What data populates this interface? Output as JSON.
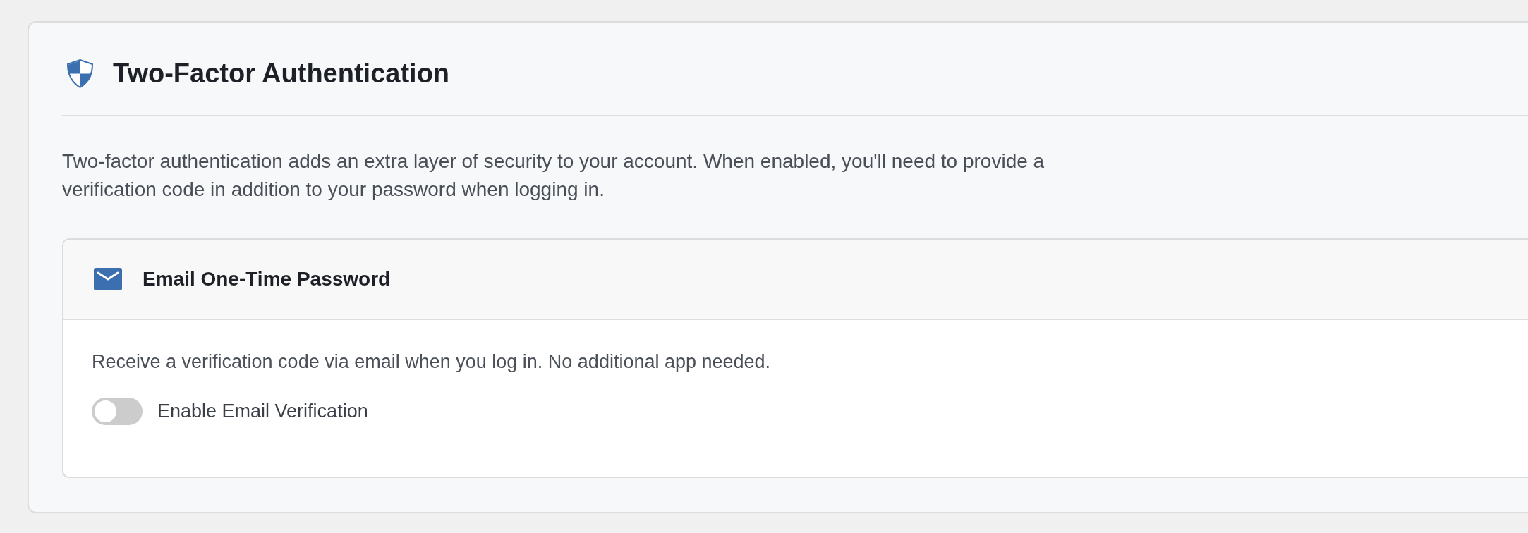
{
  "panel": {
    "title": "Two-Factor Authentication",
    "description": "Two-factor authentication adds an extra layer of security to your account. When enabled, you'll need to provide a verification code in addition to your password when logging in."
  },
  "methods": [
    {
      "title": "Email One-Time Password",
      "description": "Receive a verification code via email when you log in. No additional app needed.",
      "toggle": {
        "label": "Enable Email Verification",
        "on": false
      }
    }
  ]
}
